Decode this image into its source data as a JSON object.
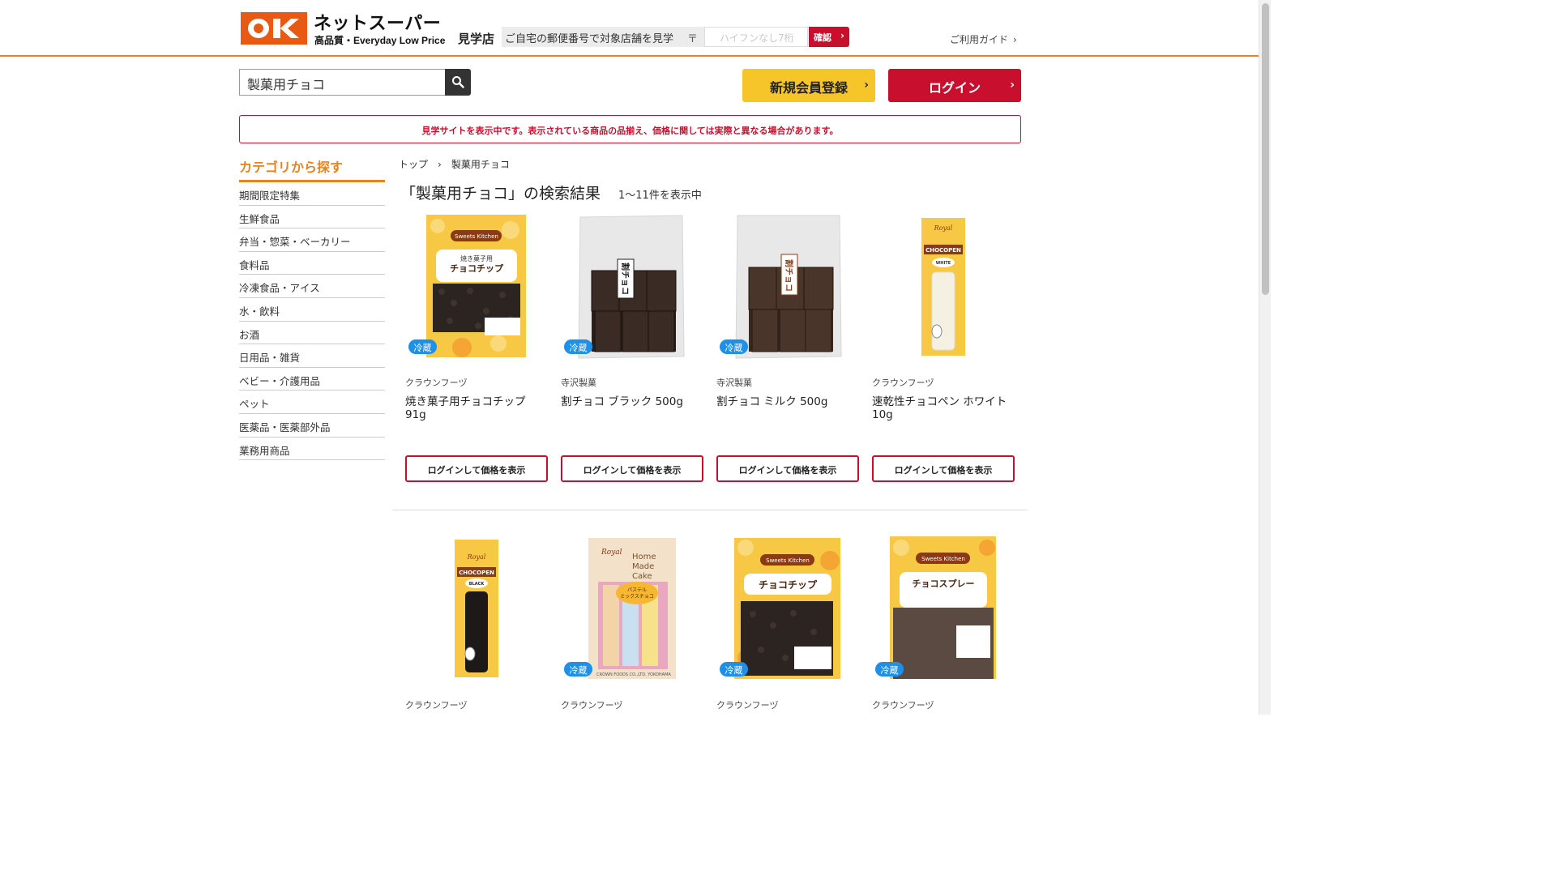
{
  "header": {
    "logo_text": "OK",
    "logo_title": "ネットスーパー",
    "logo_sub": "高品質・Everyday Low Price",
    "store_name": "見学店",
    "zip_prompt": "ご自宅の郵便番号で対象店舗を見学",
    "zip_mark": "〒",
    "zip_placeholder": "ハイフンなし7桁",
    "zip_confirm": "確認",
    "guide_label": "ご利用ガイド"
  },
  "search": {
    "value": "製菓用チョコ"
  },
  "auth": {
    "signup_label": "新規会員登録",
    "login_label": "ログイン"
  },
  "notice": "見学サイトを表示中です。表示されている商品の品揃え、価格に関しては実際と異なる場合があります。",
  "sidebar": {
    "title": "カテゴリから探す",
    "items": [
      "期間限定特集",
      "生鮮食品",
      "弁当・惣菜・ベーカリー",
      "食料品",
      "冷凍食品・アイス",
      "水・飲料",
      "お酒",
      "日用品・雑貨",
      "ベビー・介護用品",
      "ペット",
      "医薬品・医薬部外品",
      "業務用商品"
    ]
  },
  "breadcrumb": {
    "home": "トップ",
    "separator": "›",
    "current": "製菓用チョコ"
  },
  "results": {
    "title": "「製菓用チョコ」の検索結果",
    "count": "1〜11件を表示中"
  },
  "chill_label": "冷蔵",
  "price_button": "ログインして価格を表示",
  "products": [
    {
      "maker": "クラウンフーヅ",
      "name": "焼き菓子用チョコチップ 91g",
      "chilled": true,
      "pkg_text": "焼き菓子用 チョコチップ",
      "pkg_brand": "Sweets Kitchen"
    },
    {
      "maker": "寺沢製菓",
      "name": "割チョコ ブラック 500g",
      "chilled": true,
      "pkg_text": "割チョコ"
    },
    {
      "maker": "寺沢製菓",
      "name": "割チョコ ミルク 500g",
      "chilled": true,
      "pkg_text": "割チョコ"
    },
    {
      "maker": "クラウンフーヅ",
      "name": "速乾性チョコペン ホワイト 10g",
      "chilled": false,
      "pkg_text": "CHOCOPEN",
      "pkg_sub": "WHITE"
    },
    {
      "maker": "クラウンフーヅ",
      "name": "",
      "chilled": false,
      "pkg_text": "CHOCOPEN",
      "pkg_sub": "BLACK"
    },
    {
      "maker": "クラウンフーヅ",
      "name": "",
      "chilled": true,
      "pkg_text": "パステルミックスチョコ",
      "pkg_brand": "Home Made Cake"
    },
    {
      "maker": "クラウンフーヅ",
      "name": "",
      "chilled": true,
      "pkg_text": "チョコチップ",
      "pkg_brand": "Sweets Kitchen"
    },
    {
      "maker": "クラウンフーヅ",
      "name": "",
      "chilled": true,
      "pkg_text": "チョコスプレー",
      "pkg_brand": "Sweets Kitchen"
    }
  ],
  "colors": {
    "brand_orange": "#e8821e",
    "brand_red": "#c8102e",
    "signup_yellow": "#f6c529",
    "chill_blue": "#1e90e8"
  }
}
